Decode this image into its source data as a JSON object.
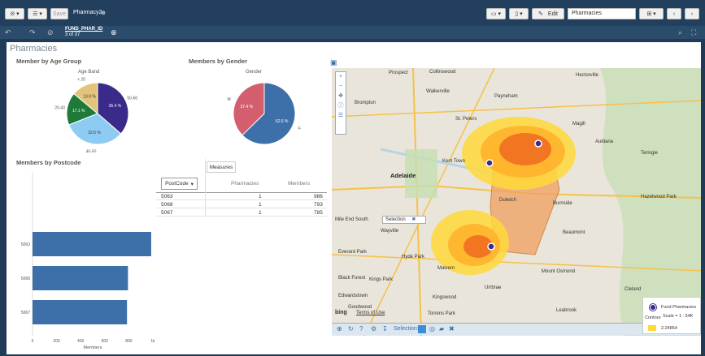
{
  "toolbar": {
    "save_label": "Save",
    "app_name": "Pharmacy2",
    "edit_label": "Edit",
    "sheet_select": "Pharmacies"
  },
  "selection": {
    "field": "FUND_PHAR_ID",
    "count": "3 of 37"
  },
  "sheet": {
    "title": "Pharmacies"
  },
  "age_chart": {
    "title": "Member by Age Group",
    "dimension": "Age Band",
    "chart_data": {
      "type": "pie",
      "categories": [
        "50-60",
        "40-50",
        "20-40",
        "< 20"
      ],
      "values": [
        36.4,
        32.6,
        17.1,
        13.9
      ],
      "labels": [
        "36.4 %",
        "32.6 %",
        "17.1 %",
        "13.9 %"
      ],
      "colors": [
        "#3a2a8a",
        "#8ecbf2",
        "#1f7a3a",
        "#e3c47a"
      ],
      "outer_labels": [
        "50-60",
        "40-50",
        "20-40",
        "< 20"
      ]
    }
  },
  "gender_chart": {
    "title": "Members by Gender",
    "dimension": "Gender",
    "chart_data": {
      "type": "pie",
      "categories": [
        "F",
        "M"
      ],
      "values": [
        62.6,
        37.4
      ],
      "labels": [
        "62.6 %",
        "37.4 %"
      ],
      "colors": [
        "#3d6fa8",
        "#d35f6e"
      ],
      "outer_labels": [
        "F",
        "M"
      ]
    }
  },
  "postcode_chart": {
    "title": "Members by Postcode",
    "chart_data": {
      "type": "bar",
      "orientation": "horizontal",
      "categories": [
        "5063",
        "5068",
        "5067"
      ],
      "values": [
        986,
        793,
        785
      ],
      "xlim": [
        0,
        1000
      ],
      "xticks": [
        "0",
        "200",
        "400",
        "600",
        "800",
        "1k"
      ],
      "xlabel": "Members",
      "color": "#3d6fa8"
    }
  },
  "table": {
    "measures_label": "Measures",
    "postcode_label": "PostCode",
    "columns": [
      "Pharmacies",
      "Members"
    ],
    "rows": [
      {
        "postcode": "5063",
        "pharmacies": "1",
        "members": "986"
      },
      {
        "postcode": "5068",
        "pharmacies": "1",
        "members": "793"
      },
      {
        "postcode": "5067",
        "pharmacies": "1",
        "members": "785"
      }
    ]
  },
  "map": {
    "places": [
      "Prospect",
      "Collinswood",
      "Walkerville",
      "Hectorville",
      "Brompton",
      "St. Peters",
      "Payneham",
      "Magill",
      "Auldana",
      "Teringie",
      "Adelaide",
      "Kent Town",
      "Dulwich",
      "Burnside",
      "Mile End South",
      "Wayville",
      "Beaumont",
      "Hazelwood Park",
      "Hyde Park",
      "Malvern",
      "Everard Park",
      "Mount Osmond",
      "Black Forest",
      "Kings Park",
      "Urrbrae",
      "Edwardstown",
      "Kingswood",
      "Cleland",
      "Torrens Park",
      "Leabrook",
      "Goodwood"
    ],
    "selection_tooltip": "Selection",
    "legend_title": "Fund Pharmacies",
    "legend_scale": "Scale = 1 : 54K",
    "legend_contour": "Contour",
    "legend_value": "2.24854",
    "selection_label": "Selection:",
    "bing_label": "bing",
    "terms_label": "Terms of Use"
  }
}
